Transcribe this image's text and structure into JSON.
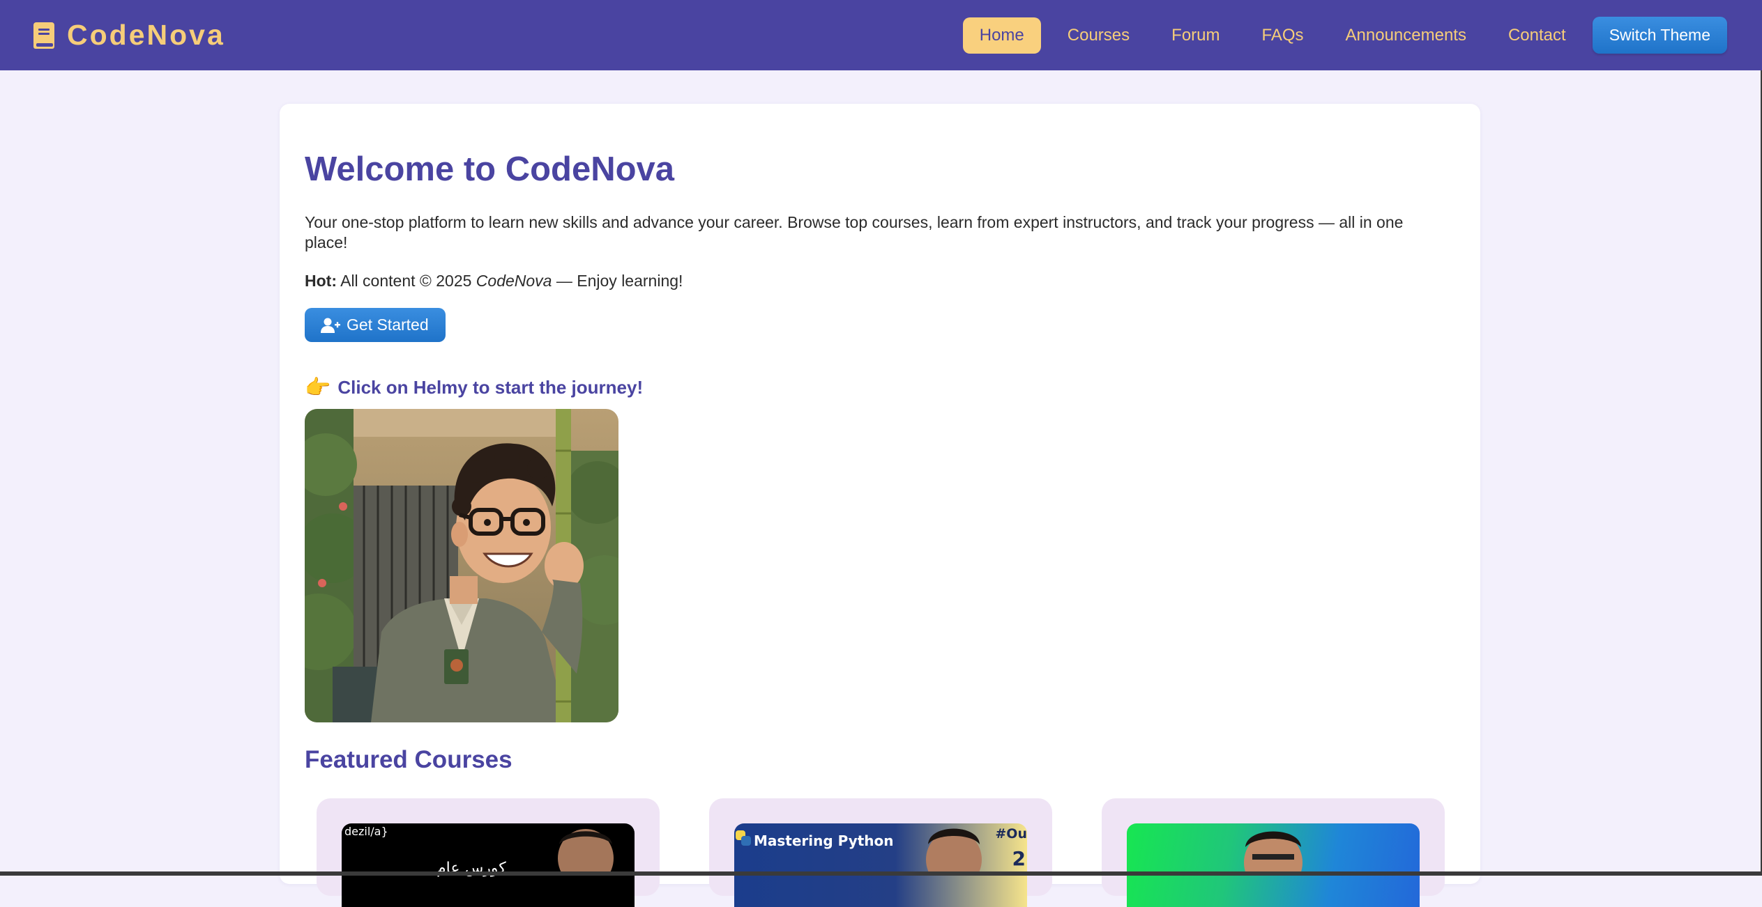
{
  "brand": {
    "name": "CodeNova",
    "icon": "book-icon",
    "color": "#f6cd79"
  },
  "nav": {
    "items": [
      {
        "label": "Home",
        "active": true
      },
      {
        "label": "Courses",
        "active": false
      },
      {
        "label": "Forum",
        "active": false
      },
      {
        "label": "FAQs",
        "active": false
      },
      {
        "label": "Announcements",
        "active": false
      },
      {
        "label": "Contact",
        "active": false
      }
    ],
    "theme_button": "Switch Theme"
  },
  "hero": {
    "title": "Welcome to CodeNova",
    "intro": "Your one-stop platform to learn new skills and advance your career. Browse top courses, learn from expert instructors, and track your progress — all in one place!",
    "hot_label": "Hot:",
    "hot_text_before": " All content © 2025 ",
    "hot_brand": "CodeNova",
    "hot_text_after": " — Enjoy learning!",
    "cta_label": "Get Started",
    "cta_icon": "user-plus-icon"
  },
  "helmy": {
    "prompt": "Click on Helmy to start the journey!",
    "prompt_icon": "pointing-hand-icon",
    "image_alt": "Helmy character illustration"
  },
  "featured": {
    "title": "Featured Courses",
    "courses": [
      {
        "thumb_text": "dezil/a}",
        "thumb_text_2": "كورس عام"
      },
      {
        "thumb_text": "Mastering Python",
        "badge": "#Ou",
        "badge_2": "2"
      },
      {
        "thumb_text": ""
      }
    ]
  },
  "colors": {
    "navbar": "#4a44a1",
    "accent": "#f6cd79",
    "primary_button": "#2a80d6",
    "page_bg": "#f3f0fc",
    "title": "#4a44a1"
  }
}
